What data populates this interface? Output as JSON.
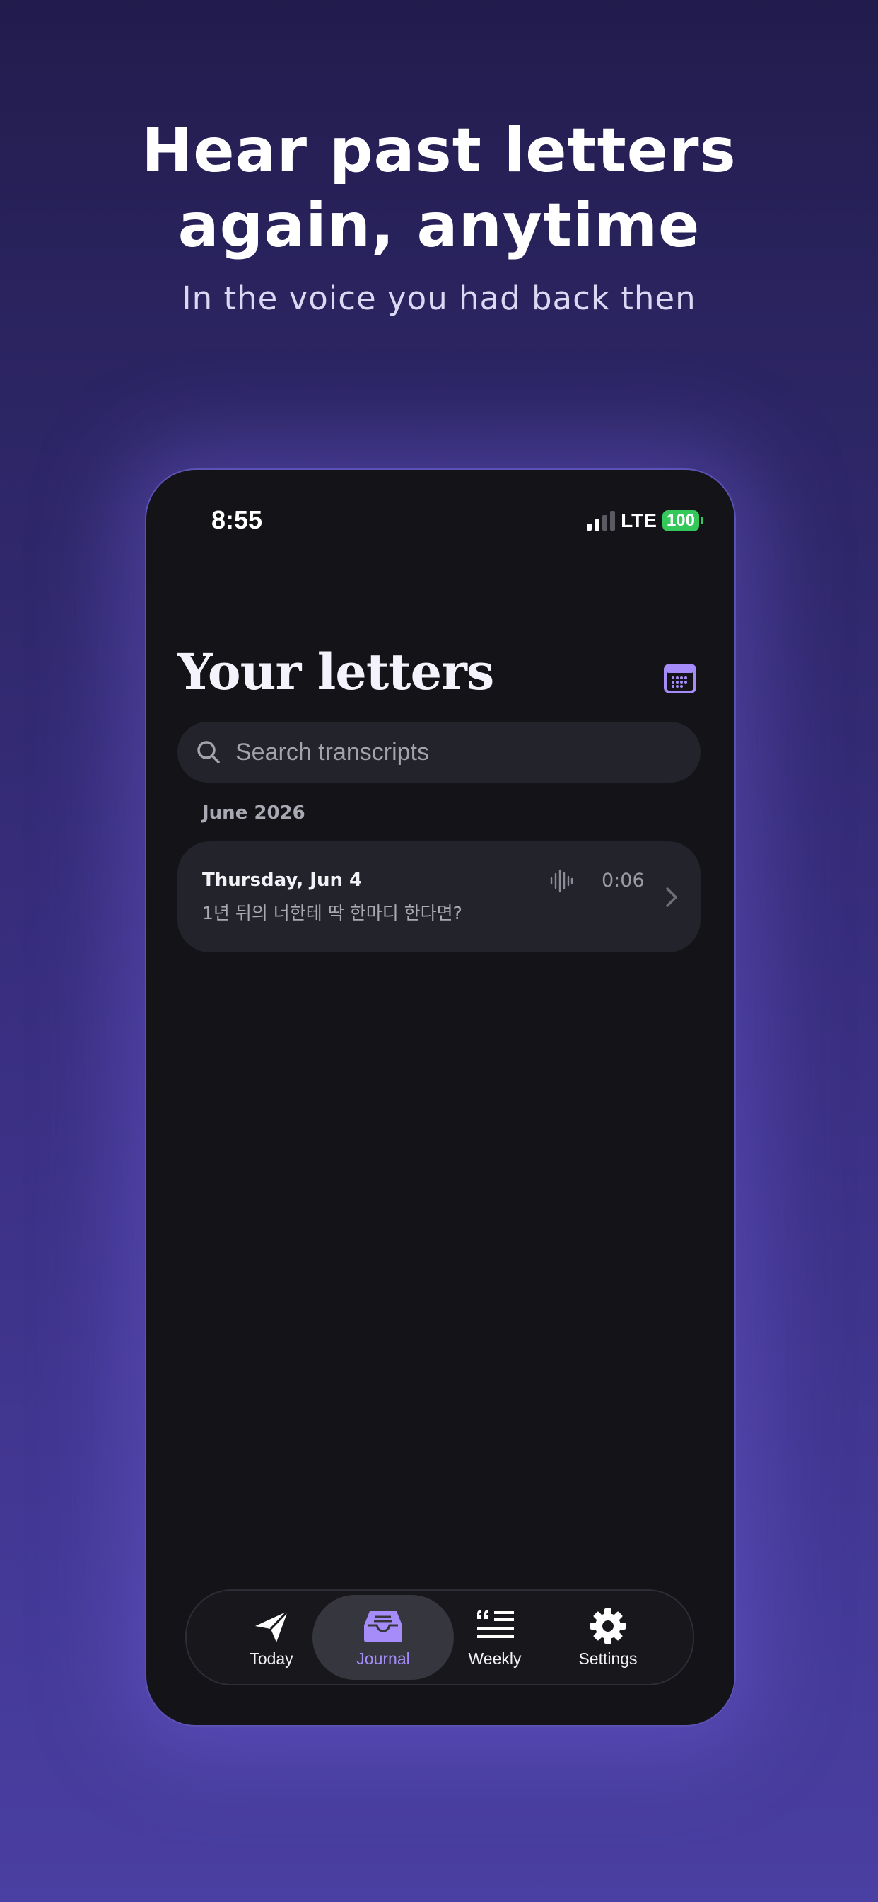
{
  "promo": {
    "headline_line1": "Hear past letters",
    "headline_line2": "again, anytime",
    "subhead": "In the voice you had back then"
  },
  "status_bar": {
    "time": "8:55",
    "network": "LTE",
    "battery": "100"
  },
  "journal": {
    "title": "Your letters",
    "calendar_icon": "calendar-icon",
    "search_placeholder": "Search transcripts",
    "section": "June 2026",
    "entries": [
      {
        "date": "Thursday, Jun 4",
        "preview": "1년 뒤의 너한테 딱 한마디 한다면?",
        "duration": "0:06",
        "icon": "audio-waveform-icon"
      }
    ]
  },
  "tabbar": {
    "tabs": [
      {
        "label": "Today",
        "icon": "paper-plane-icon"
      },
      {
        "label": "Journal",
        "icon": "inbox-tray-icon"
      },
      {
        "label": "Weekly",
        "icon": "quote-list-icon"
      },
      {
        "label": "Settings",
        "icon": "gear-icon"
      }
    ],
    "active": "Journal"
  },
  "colors": {
    "accent": "#a58cf8",
    "battery": "#34c759",
    "screen_bg": "#131318",
    "card_bg": "#23232c"
  }
}
